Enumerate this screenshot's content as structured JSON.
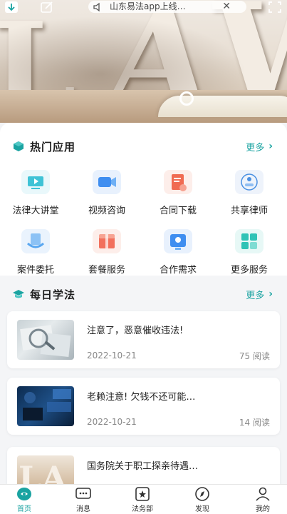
{
  "notice_bar": {
    "text": "山东易法app上线…",
    "close": "✕"
  },
  "hot_apps": {
    "title": "热门应用",
    "more": "更多",
    "items": [
      {
        "label": "法律大讲堂",
        "icon": "video-lecture-icon",
        "color": "#3fc3d6"
      },
      {
        "label": "视频咨询",
        "icon": "video-camera-icon",
        "color": "#3f8ef0"
      },
      {
        "label": "合同下载",
        "icon": "contract-download-icon",
        "color": "#f06b52"
      },
      {
        "label": "共享律师",
        "icon": "shared-lawyer-icon",
        "color": "#4a90e2"
      },
      {
        "label": "案件委托",
        "icon": "case-entrust-icon",
        "color": "#5aa7f0"
      },
      {
        "label": "套餐服务",
        "icon": "package-service-icon",
        "color": "#f2705c"
      },
      {
        "label": "合作需求",
        "icon": "cooperation-icon",
        "color": "#3f8ef0"
      },
      {
        "label": "更多服务",
        "icon": "more-services-icon",
        "color": "#2fc3b6"
      }
    ]
  },
  "daily_learning": {
    "title": "每日学法",
    "more": "更多",
    "articles": [
      {
        "title": "注意了，恶意催收违法!",
        "date": "2022-10-21",
        "reads": "75 阅读"
      },
      {
        "title": "老赖注意! 欠钱不还可能…",
        "date": "2022-10-21",
        "reads": "14 阅读"
      },
      {
        "title": "国务院关于职工探亲待遇…",
        "date": "",
        "reads": ""
      }
    ]
  },
  "tabbar": {
    "items": [
      {
        "label": "首页",
        "icon": "home-icon",
        "active": true
      },
      {
        "label": "消息",
        "icon": "message-icon",
        "active": false
      },
      {
        "label": "法务部",
        "icon": "legal-dept-icon",
        "active": false
      },
      {
        "label": "发现",
        "icon": "discover-icon",
        "active": false
      },
      {
        "label": "我的",
        "icon": "profile-icon",
        "active": false
      }
    ]
  },
  "colors": {
    "accent": "#1aa3a1",
    "section_title": "#1d1d1d"
  }
}
